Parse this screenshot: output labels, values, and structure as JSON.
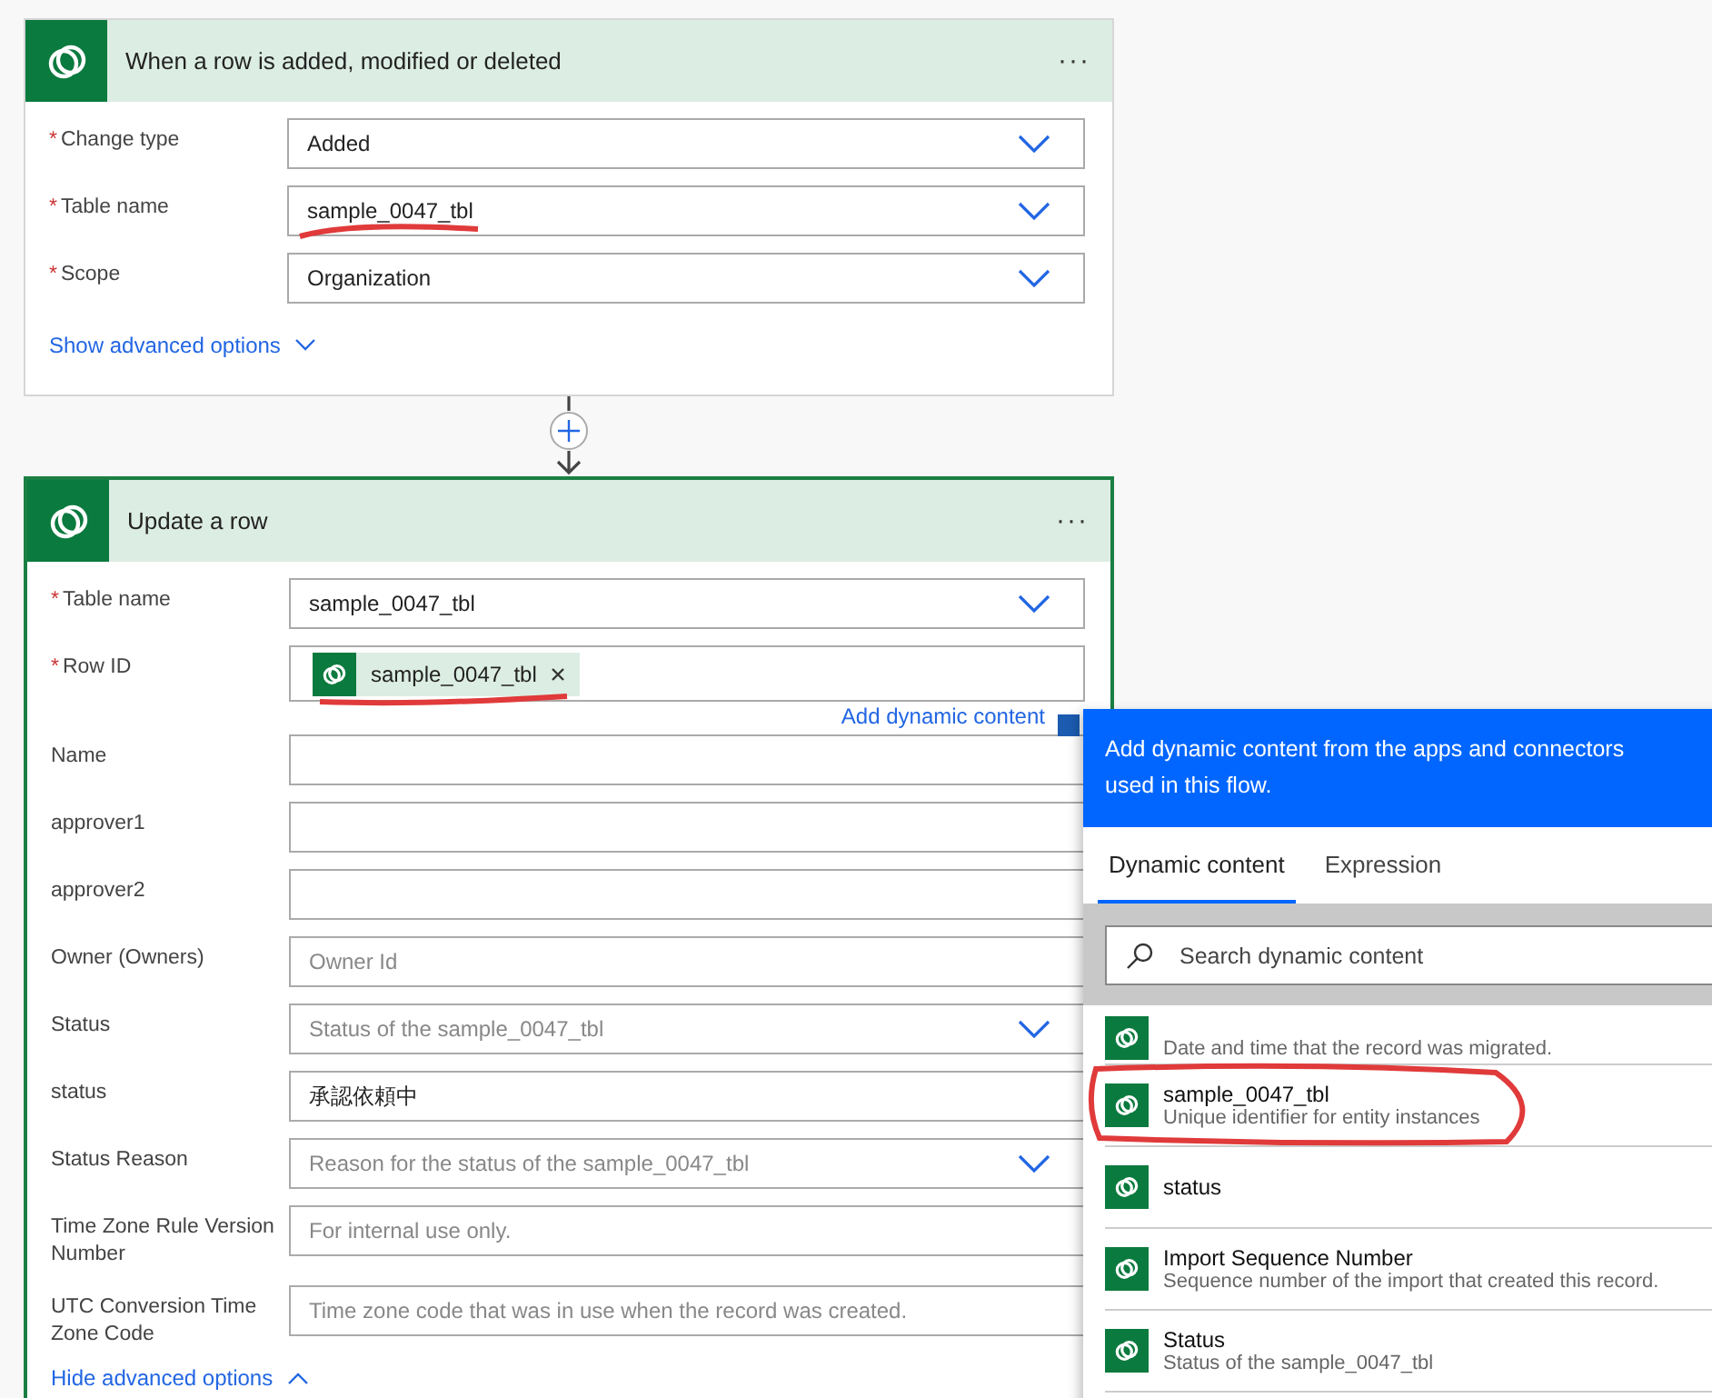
{
  "trigger": {
    "title": "When a row is added, modified or deleted",
    "menu": "···",
    "fields": [
      {
        "label": "Change type",
        "required_mark": "*",
        "kind": "dropdown",
        "value": "Added"
      },
      {
        "label": "Table name",
        "required_mark": "*",
        "kind": "dropdown",
        "value": "sample_0047_tbl",
        "marked": true
      },
      {
        "label": "Scope",
        "required_mark": "*",
        "kind": "dropdown",
        "value": "Organization"
      }
    ],
    "options_link": {
      "label": "Show advanced options",
      "expanded": false
    }
  },
  "action": {
    "title": "Update a row",
    "menu": "···",
    "fields": [
      {
        "label": "Table name",
        "required_mark": "*",
        "kind": "dropdown",
        "value": "sample_0047_tbl"
      },
      {
        "label": "Row ID",
        "required_mark": "*",
        "kind": "token",
        "token": "sample_0047_tbl",
        "marked": true
      },
      {
        "label": "Name",
        "kind": "text"
      },
      {
        "label": "approver1",
        "kind": "text"
      },
      {
        "label": "approver2",
        "kind": "text"
      },
      {
        "label": "Owner (Owners)",
        "kind": "text",
        "placeholder": "Owner Id"
      },
      {
        "label": "Status",
        "kind": "dropdown",
        "placeholder": "Status of the sample_0047_tbl"
      },
      {
        "label": "status",
        "kind": "text",
        "value": "承認依頼中"
      },
      {
        "label": "Status Reason",
        "kind": "dropdown",
        "placeholder": "Reason for the status of the sample_0047_tbl"
      },
      {
        "label": "Time Zone Rule Version Number",
        "kind": "text",
        "placeholder": "For internal use only."
      },
      {
        "label": "UTC Conversion Time Zone Code",
        "kind": "text",
        "placeholder": "Time zone code that was in use when the record was created."
      }
    ],
    "dynamic_link": "Add dynamic content",
    "options_link": {
      "label": "Hide advanced options",
      "expanded": true
    }
  },
  "popup": {
    "header": "Add dynamic content from the apps and connectors used in this flow.",
    "tabs": [
      {
        "label": "Dynamic content",
        "selected": true
      },
      {
        "label": "Expression",
        "selected": false
      }
    ],
    "search": {
      "placeholder": "Search dynamic content"
    },
    "items": [
      {
        "description": "Date and time that the record was migrated."
      },
      {
        "title": "sample_0047_tbl",
        "description": "Unique identifier for entity instances",
        "marked": true
      },
      {
        "title": "status"
      },
      {
        "title": "Import Sequence Number",
        "description": "Sequence number of the import that created this record."
      },
      {
        "title": "Status",
        "description": "Status of the sample_0047_tbl"
      }
    ]
  }
}
